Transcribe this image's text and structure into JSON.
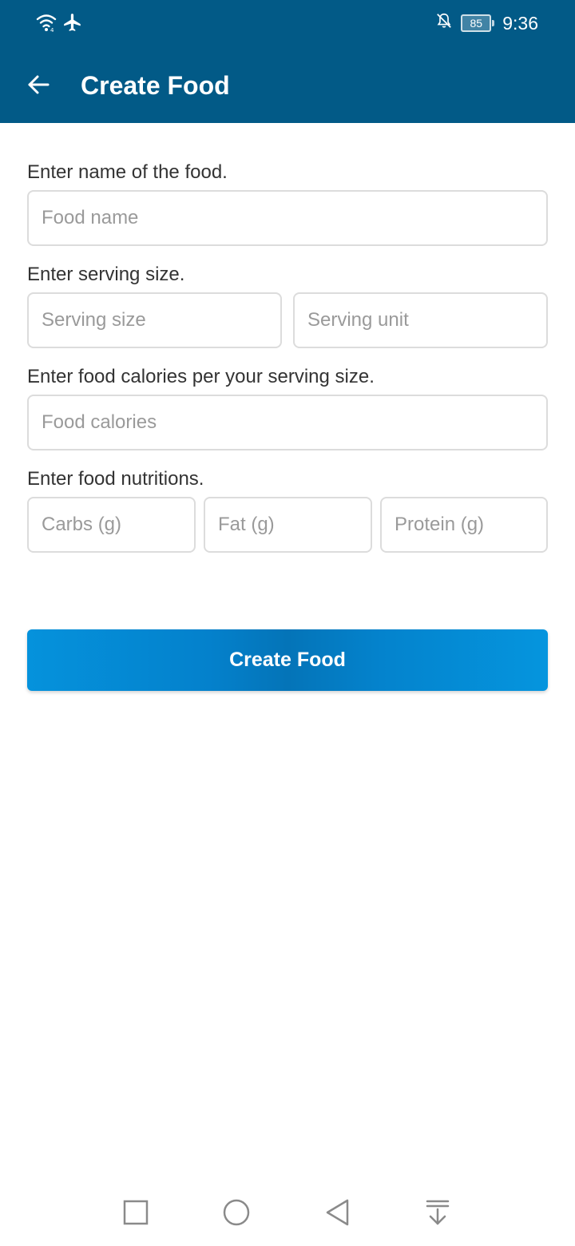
{
  "status_bar": {
    "time": "9:36",
    "battery_level": "85",
    "icons": [
      "wifi-icon",
      "airplane-mode-icon",
      "notifications-off-icon",
      "battery-icon"
    ]
  },
  "toolbar": {
    "title": "Create Food",
    "back_icon": "arrow-left-icon",
    "background_color": "#025a87"
  },
  "form": {
    "name_label": "Enter name of the food.",
    "name_placeholder": "Food name",
    "serving_label": "Enter serving size.",
    "serving_size_placeholder": "Serving size",
    "serving_unit_placeholder": "Serving unit",
    "calories_label": "Enter food calories per your serving size.",
    "calories_placeholder": "Food calories",
    "nutrition_label": "Enter food nutritions.",
    "carbs_placeholder": "Carbs (g)",
    "fat_placeholder": "Fat (g)",
    "protein_placeholder": "Protein (g)"
  },
  "actions": {
    "create_label": "Create Food",
    "button_color": "#0487d0"
  },
  "nav_bar": {
    "icons": [
      "recent-apps-icon",
      "home-icon",
      "back-triangle-icon",
      "notification-shade-icon"
    ]
  }
}
